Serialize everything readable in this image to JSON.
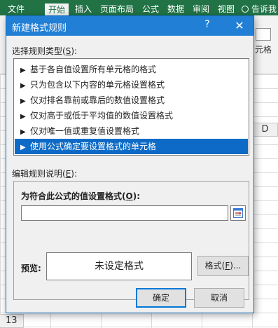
{
  "excel": {
    "tabs": [
      "文件",
      "开始",
      "插入",
      "页面布局",
      "公式",
      "数据",
      "审阅",
      "视图"
    ],
    "active_tab": "开始",
    "tell_me": "告诉我",
    "style_button_label": "元格",
    "column_header": "D",
    "row_number": "13",
    "faint_cell_text": "奴刺",
    "header_color": "#217346"
  },
  "dialog": {
    "title": "新建格式规则",
    "help_symbol": "?",
    "close_symbol": "✕",
    "rule_type_label": "选择规则类型(",
    "rule_type_key": "S",
    "rule_type_suffix": "):",
    "rule_types": [
      "基于各自值设置所有单元格的格式",
      "只为包含以下内容的单元格设置格式",
      "仅对排名靠前或靠后的数值设置格式",
      "仅对高于或低于平均值的数值设置格式",
      "仅对唯一值或重复值设置格式",
      "使用公式确定要设置格式的单元格"
    ],
    "selected_rule_index": 5,
    "edit_desc_label": "编辑规则说明(",
    "edit_desc_key": "E",
    "edit_desc_suffix": "):",
    "formula_label": "为符合此公式的值设置格式(",
    "formula_key": "O",
    "formula_suffix": "):",
    "formula_value": "",
    "preview_label": "预览:",
    "preview_text": "未设定格式",
    "format_button": "格式(",
    "format_button_key": "F",
    "format_button_suffix": ")...",
    "ok_button": "确定",
    "cancel_button": "取消",
    "selection_color": "#0d6bc7",
    "titlebar_color": "#217fd6"
  }
}
